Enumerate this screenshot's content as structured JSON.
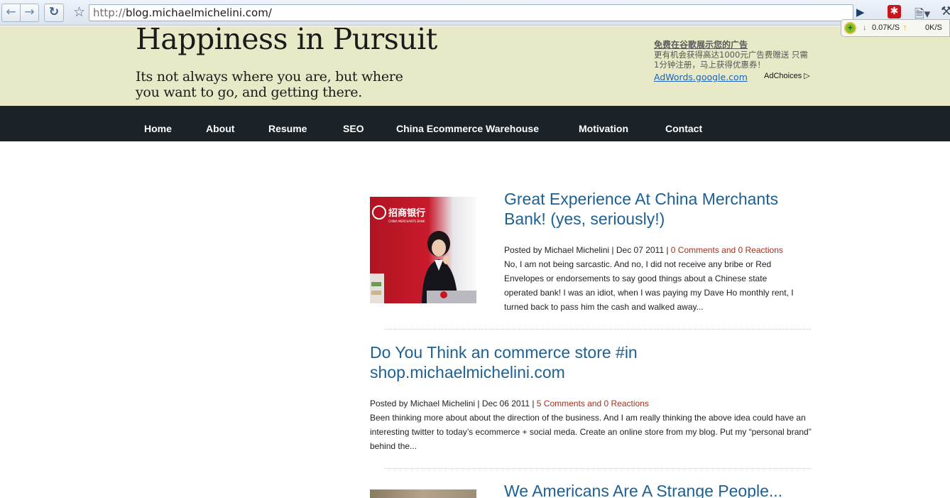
{
  "browser": {
    "url_scheme": "http://",
    "url_host": "blog.michaelmichelini.com/",
    "icons": {
      "back": "arrow-left-icon",
      "forward": "arrow-right-icon",
      "reload": "reload-icon",
      "bookmark": "star-icon",
      "go": "play-icon",
      "extension": "extension-icon",
      "page_menu": "page-icon",
      "tools_menu": "wrench-icon"
    },
    "speed_widget": {
      "down": "0.07K/S",
      "up": "0K/S"
    }
  },
  "header": {
    "site_title": "Happiness in Pursuit",
    "tagline": "Its not always where you are, but where you want to go, and getting there.",
    "background_color": "#e8eac7"
  },
  "ad": {
    "title": "免费在谷歌展示您的广告",
    "body": "更有机会获得高达1000元广告费赠送 只需1分钟注册，马上获得优惠券！",
    "link": "AdWords.google.com",
    "adchoices": "AdChoices"
  },
  "nav": {
    "items": [
      {
        "label": "Home"
      },
      {
        "label": "About"
      },
      {
        "label": "Resume"
      },
      {
        "label": "SEO"
      },
      {
        "label": "China Ecommerce Warehouse"
      },
      {
        "label": "Motivation"
      },
      {
        "label": "Contact"
      }
    ],
    "background_color": "#1b2329"
  },
  "posts": [
    {
      "title": "Great Experience At China Merchants Bank! (yes, seriously!)",
      "meta_prefix": "Posted by Michael Michelini | Dec 07 2011 | ",
      "comments": "0 Comments and 0 Reactions",
      "excerpt": "No, I am not being sarcastic. And no, I did not receive any bribe or Red Envelopes or endorsements to say good things about a Chinese state operated bank! I was an idiot, when I was paying my Dave Ho monthly rent, I turned back to pass him the cash and walked away...",
      "thumb_sign": "招商银行",
      "thumb_sign_sub": "CHINA MERCHANTS BANK"
    },
    {
      "title": "Do You Think an commerce store #in shop.michaelmichelini.com",
      "meta_prefix": "Posted by Michael Michelini | Dec 06 2011 | ",
      "comments": "5 Comments and 0 Reactions",
      "excerpt": "Been thinking more about about the direction of the business. And I am really thinking the above idea could have an interesting twitter to today’s ecommerce + social meda. Create an online store from my blog. Put my “personal brand” behind the..."
    },
    {
      "title": "We Americans Are A Strange People..."
    }
  ],
  "colors": {
    "link_title": "#1d6094",
    "comments_link": "#a3301d"
  }
}
